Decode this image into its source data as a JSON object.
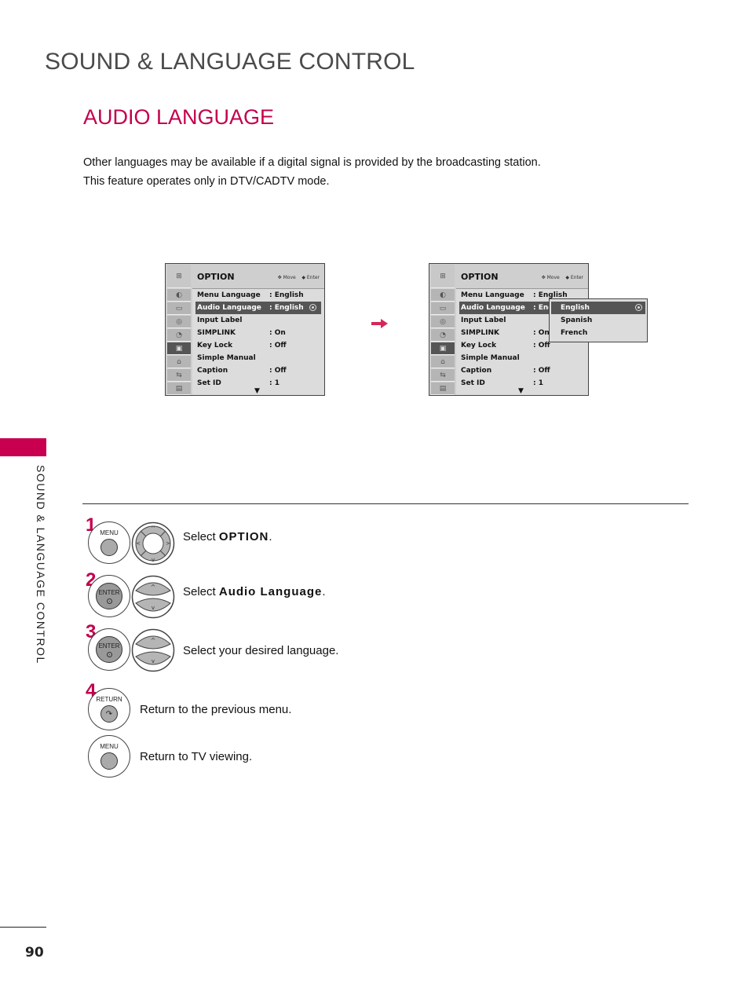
{
  "header": {
    "page_title": "SOUND & LANGUAGE CONTROL",
    "section_title": "AUDIO LANGUAGE",
    "intro_lines": [
      "Other languages may be available if a digital signal is provided by the broadcasting station.",
      "This feature operates only in DTV/CADTV mode."
    ]
  },
  "side_label": "SOUND & LANGUAGE CONTROL",
  "page_number": "90",
  "accent_color": "#c3004d",
  "osd_menus": [
    {
      "title": "OPTION",
      "hint_move": "Move",
      "hint_enter": "Enter",
      "rows": [
        {
          "label": "Menu Language",
          "value": ": English"
        },
        {
          "label": "Audio Language",
          "value": ": English",
          "selected": true
        },
        {
          "label": "Input Label",
          "value": ""
        },
        {
          "label": "SIMPLINK",
          "value": ": On"
        },
        {
          "label": "Key Lock",
          "value": ": Off"
        },
        {
          "label": "Simple Manual",
          "value": ""
        },
        {
          "label": "Caption",
          "value": ": Off"
        },
        {
          "label": "Set ID",
          "value": ": 1"
        }
      ]
    },
    {
      "title": "OPTION",
      "hint_move": "Move",
      "hint_enter": "Enter",
      "rows": [
        {
          "label": "Menu Language",
          "value": ": English"
        },
        {
          "label": "Audio Language",
          "value": ": Eng",
          "selected": true
        },
        {
          "label": "Input Label",
          "value": ""
        },
        {
          "label": "SIMPLINK",
          "value": ": On"
        },
        {
          "label": "Key Lock",
          "value": ": Off"
        },
        {
          "label": "Simple Manual",
          "value": ""
        },
        {
          "label": "Caption",
          "value": ": Off"
        },
        {
          "label": "Set ID",
          "value": ": 1"
        }
      ],
      "popup_options": [
        {
          "label": "English",
          "selected": true
        },
        {
          "label": "Spanish"
        },
        {
          "label": "French"
        }
      ]
    }
  ],
  "steps": [
    {
      "num": "1",
      "button": "MENU",
      "text_prefix": "Select ",
      "text_bold": "OPTION",
      "text_suffix": "."
    },
    {
      "num": "2",
      "button": "ENTER",
      "text_prefix": "Select ",
      "text_bold": "Audio Language",
      "text_suffix": "."
    },
    {
      "num": "3",
      "button": "ENTER",
      "text": "Select your desired language."
    },
    {
      "num": "4",
      "button": "RETURN",
      "text": "Return to the previous menu."
    },
    {
      "button": "MENU",
      "text": "Return to TV viewing."
    }
  ]
}
